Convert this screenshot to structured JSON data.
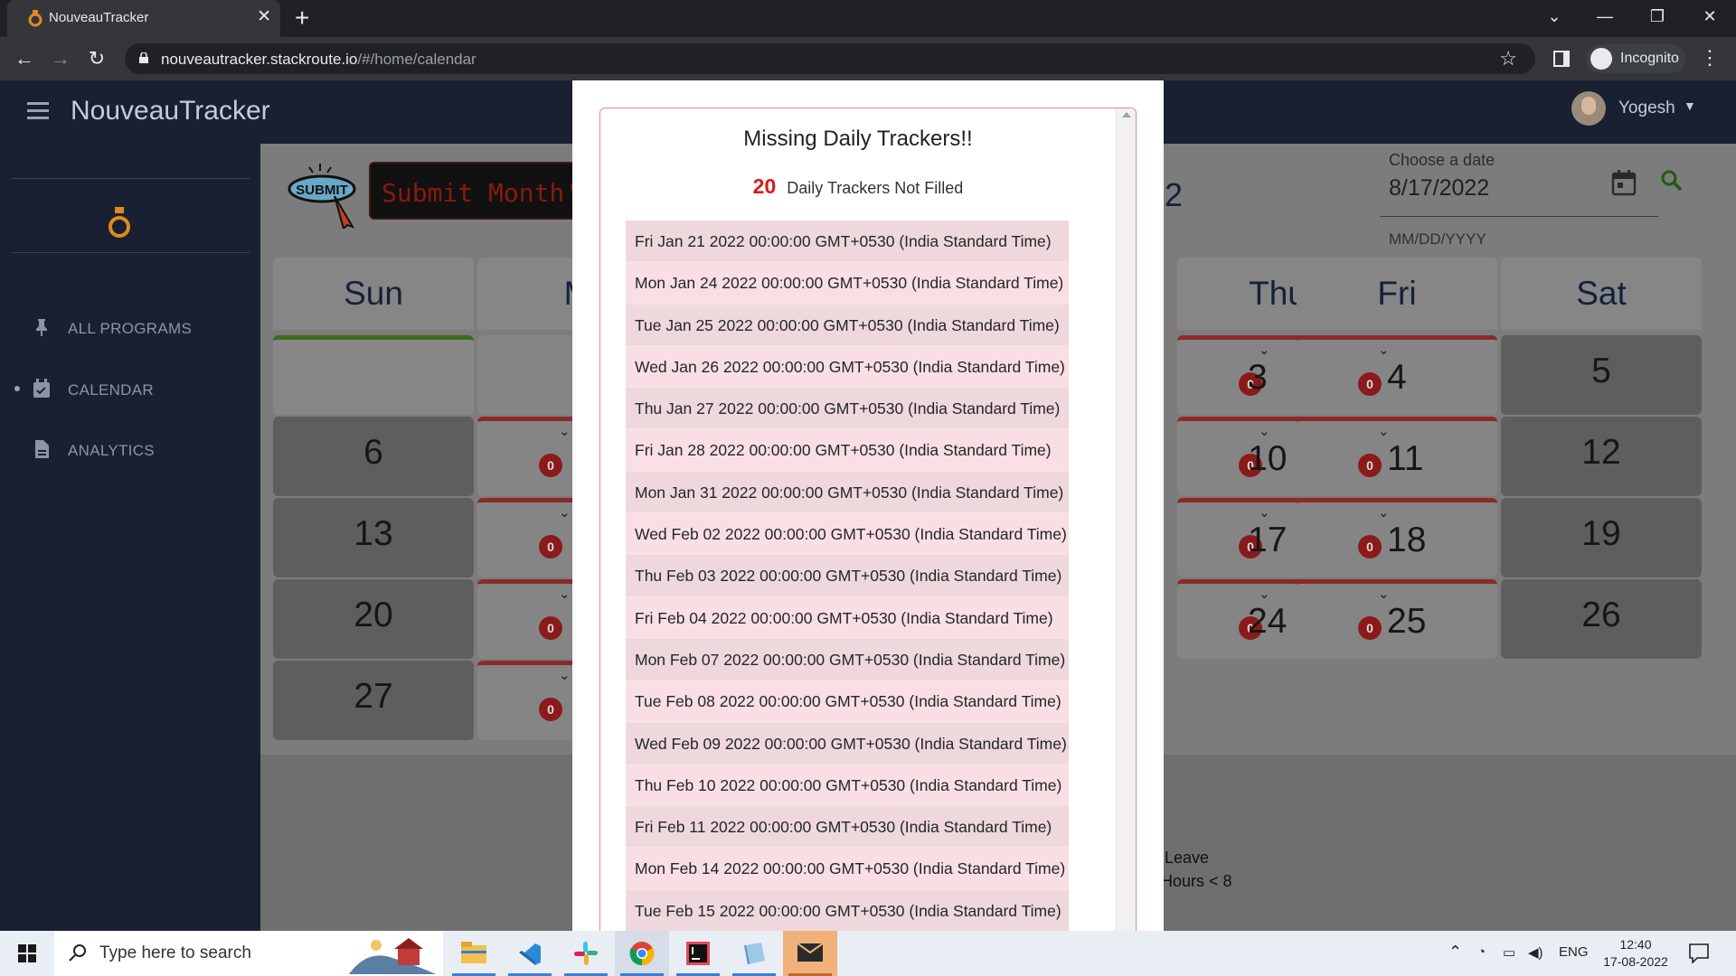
{
  "browser": {
    "tab_title": "NouveauTracker",
    "url_host": "nouveautracker.stackroute.io",
    "url_path": "/#/home/calendar",
    "profile_label": "Incognito"
  },
  "app": {
    "title": "NouveauTracker",
    "user_name": "Yogesh",
    "nav": [
      {
        "label": "ALL PROGRAMS",
        "icon": "pin-icon"
      },
      {
        "label": "CALENDAR",
        "icon": "calendar-icon"
      },
      {
        "label": "ANALYTICS",
        "icon": "document-icon"
      }
    ],
    "submit_badge": "SUBMIT",
    "banner_text": "Submit Month's F",
    "date_picker": {
      "label": "Choose a date",
      "value": "8/17/2022",
      "hint": "MM/DD/YYYY"
    },
    "weekdays": [
      "Sun",
      "M",
      "Thu",
      "Fri",
      "Sat"
    ],
    "badge_count": "0",
    "legend": [
      "Leave",
      "Hours < 8"
    ],
    "fragment_digit": "2",
    "days": {
      "thu": [
        "3",
        "10",
        "17",
        "24"
      ],
      "fri": [
        "4",
        "11",
        "18",
        "25"
      ],
      "sat": [
        "5",
        "12",
        "19",
        "26"
      ],
      "sun": [
        "6",
        "13",
        "20",
        "27"
      ]
    }
  },
  "modal": {
    "title": "Missing Daily Trackers!!",
    "count": "20",
    "count_label": "Daily Trackers Not Filled",
    "dates": [
      "Fri Jan 21 2022 00:00:00 GMT+0530 (India Standard Time)",
      "Mon Jan 24 2022 00:00:00 GMT+0530 (India Standard Time)",
      "Tue Jan 25 2022 00:00:00 GMT+0530 (India Standard Time)",
      "Wed Jan 26 2022 00:00:00 GMT+0530 (India Standard Time)",
      "Thu Jan 27 2022 00:00:00 GMT+0530 (India Standard Time)",
      "Fri Jan 28 2022 00:00:00 GMT+0530 (India Standard Time)",
      "Mon Jan 31 2022 00:00:00 GMT+0530 (India Standard Time)",
      "Wed Feb 02 2022 00:00:00 GMT+0530 (India Standard Time)",
      "Thu Feb 03 2022 00:00:00 GMT+0530 (India Standard Time)",
      "Fri Feb 04 2022 00:00:00 GMT+0530 (India Standard Time)",
      "Mon Feb 07 2022 00:00:00 GMT+0530 (India Standard Time)",
      "Tue Feb 08 2022 00:00:00 GMT+0530 (India Standard Time)",
      "Wed Feb 09 2022 00:00:00 GMT+0530 (India Standard Time)",
      "Thu Feb 10 2022 00:00:00 GMT+0530 (India Standard Time)",
      "Fri Feb 11 2022 00:00:00 GMT+0530 (India Standard Time)",
      "Mon Feb 14 2022 00:00:00 GMT+0530 (India Standard Time)",
      "Tue Feb 15 2022 00:00:00 GMT+0530 (India Standard Time)"
    ]
  },
  "taskbar": {
    "search_placeholder": "Type here to search",
    "language": "ENG",
    "time": "12:40",
    "date": "17-08-2022"
  },
  "colors": {
    "sidebar_bg": "#182032",
    "accent_red": "#d61a1a",
    "row_pink": "#f9dfe4",
    "logo_orange": "#e08a1e"
  }
}
